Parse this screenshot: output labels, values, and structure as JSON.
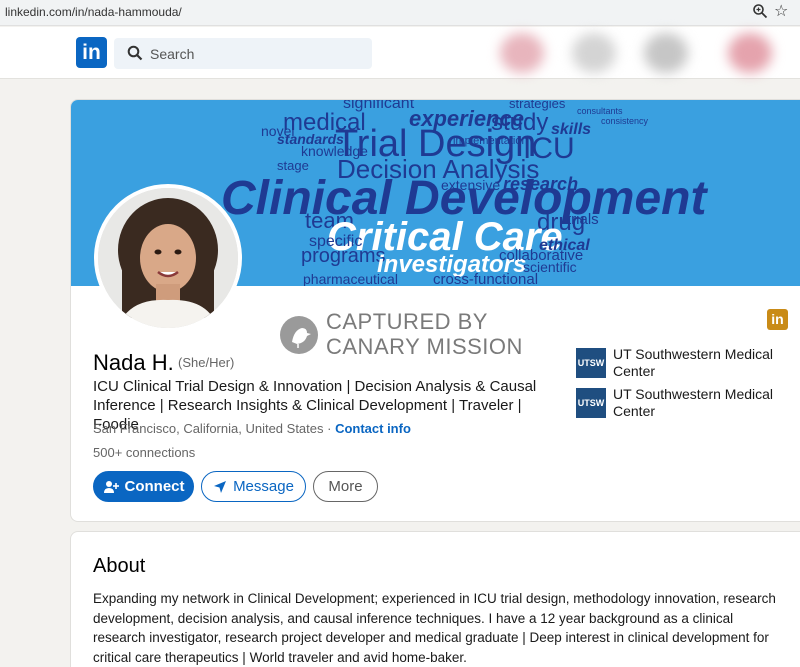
{
  "browser": {
    "url": "linkedin.com/in/nada-hammouda/",
    "zoom_icon": "zoom-icon",
    "star_icon": "bookmark-star-icon"
  },
  "nav": {
    "logo": "in",
    "search_placeholder": "Search"
  },
  "banner": {
    "words": [
      "significant",
      "experience",
      "strategies",
      "medical",
      "study",
      "standards",
      "Trial Design",
      "ICU",
      "skills",
      "novel",
      "knowledge",
      "Decision Analysis",
      "research",
      "extensive",
      "Clinical Development",
      "team",
      "drug",
      "trials",
      "Critical Care",
      "specific",
      "ethical",
      "programs",
      "investigators",
      "collaborative",
      "scientific",
      "pharmaceutical",
      "cross-functional",
      "implementation",
      "consultants",
      "consistency",
      "stage"
    ]
  },
  "watermark": {
    "line1": "CAPTURED BY",
    "line2": "CANARY MISSION"
  },
  "profile": {
    "name": "Nada H.",
    "pronouns": "(She/Her)",
    "headline": "ICU Clinical Trial Design & Innovation | Decision Analysis & Causal Inference | Research Insights & Clinical Development | Traveler | Foodie",
    "location": "San Francisco, California, United States",
    "location_sep": " · ",
    "contact_label": "Contact info",
    "connections": "500+ connections",
    "badge": "in"
  },
  "actions": {
    "connect": "Connect",
    "message": "Message",
    "more": "More"
  },
  "orgs": [
    {
      "logo": "UTSW",
      "name": "UT Southwestern Medical Center"
    },
    {
      "logo": "UTSW",
      "name": "UT Southwestern Medical Center"
    }
  ],
  "about": {
    "title": "About",
    "text": "Expanding my network in Clinical Development; experienced in ICU trial design, methodology innovation, research development, decision analysis, and causal inference techniques. I have a 12 year background as a clinical research investigator, research project developer and medical graduate | Deep interest in clinical development for critical care therapeutics | World traveler and avid home-baker."
  },
  "colors": {
    "brand": "#0a66c2",
    "banner_bg": "#3aa0e0",
    "banner_text_dark": "#1f3a93",
    "banner_text_light": "#ffffff",
    "badge": "#c98b17",
    "org_logo": "#1f4e80"
  }
}
